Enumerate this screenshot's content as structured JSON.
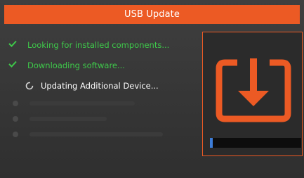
{
  "window": {
    "title": "USB Update"
  },
  "steps": [
    {
      "label": "Looking for installed components...",
      "status": "done"
    },
    {
      "label": "Downloading software...",
      "status": "done"
    },
    {
      "label": "Updating Additional Device...",
      "status": "in-progress"
    }
  ],
  "pending_steps_count": 3,
  "progress": {
    "fraction": 0.03
  },
  "icons": {
    "done": "check-icon",
    "in_progress": "spinner-icon",
    "panel": "download-icon"
  },
  "colors": {
    "accent": "#ec5a24",
    "done_text": "#3ec94a",
    "progress": "#3d7dd8"
  }
}
